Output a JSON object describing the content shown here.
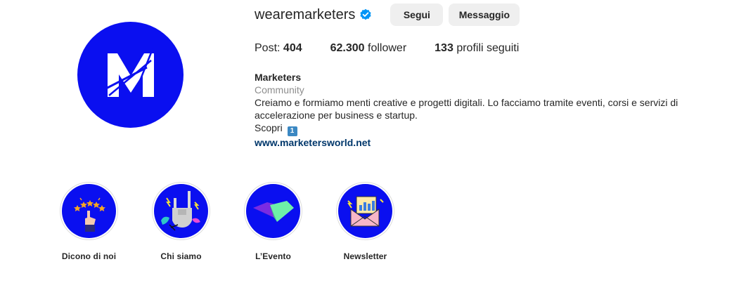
{
  "profile": {
    "username": "wearemarketers",
    "verified_icon": "verified-badge-icon",
    "follow_label": "Segui",
    "message_label": "Messaggio",
    "avatar_icon": "marketers-m-logo"
  },
  "stats": {
    "posts_label": "Post:",
    "posts_value": "404",
    "followers_value": "62.300",
    "followers_label": "follower",
    "following_value": "133",
    "following_label": "profili seguiti"
  },
  "bio": {
    "name": "Marketers",
    "category": "Community",
    "description": "Creiamo e formiamo menti creative e progetti digitali. Lo facciamo tramite eventi, corsi e servizi di accelerazione per business e startup.",
    "cta": "Scopri",
    "cta_emoji": "1",
    "website": "www.marketersworld.net"
  },
  "highlights": [
    {
      "label": "Dicono di noi",
      "icon": "stars-hand-icon"
    },
    {
      "label": "Chi siamo",
      "icon": "rock-hand-icon"
    },
    {
      "label": "L’Evento",
      "icon": "diamond-logo-icon"
    },
    {
      "label": "Newsletter",
      "icon": "envelope-icon"
    }
  ],
  "colors": {
    "brand_blue": "#0a0ff0",
    "button_bg": "#efefef",
    "link": "#00376b",
    "muted": "#8e8e8e",
    "verified": "#0095f6"
  }
}
